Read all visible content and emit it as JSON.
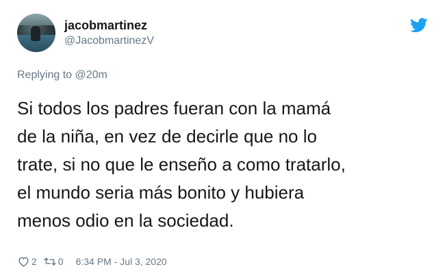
{
  "user": {
    "display_name": "jacobmartinez",
    "handle": "@JacobmartinezV"
  },
  "reply": {
    "prefix": "Replying to",
    "mention": "@20m"
  },
  "tweet": {
    "text": "Si todos los padres fueran con la mamá\nde la niña, en vez de decirle que no lo\ntrate, si no que le enseño a como tratarlo,\nel mundo seria más bonito y hubiera\nmenos odio en la sociedad."
  },
  "footer": {
    "likes": "2",
    "retweets": "0",
    "timestamp": "6:34 PM - Jul 3, 2020"
  },
  "icons": {
    "brand": "twitter-bird-icon",
    "like": "heart-icon",
    "retweet": "retweet-icon"
  },
  "colors": {
    "brand": "#1DA1F2",
    "text": "#14171A",
    "secondary": "#657786"
  }
}
